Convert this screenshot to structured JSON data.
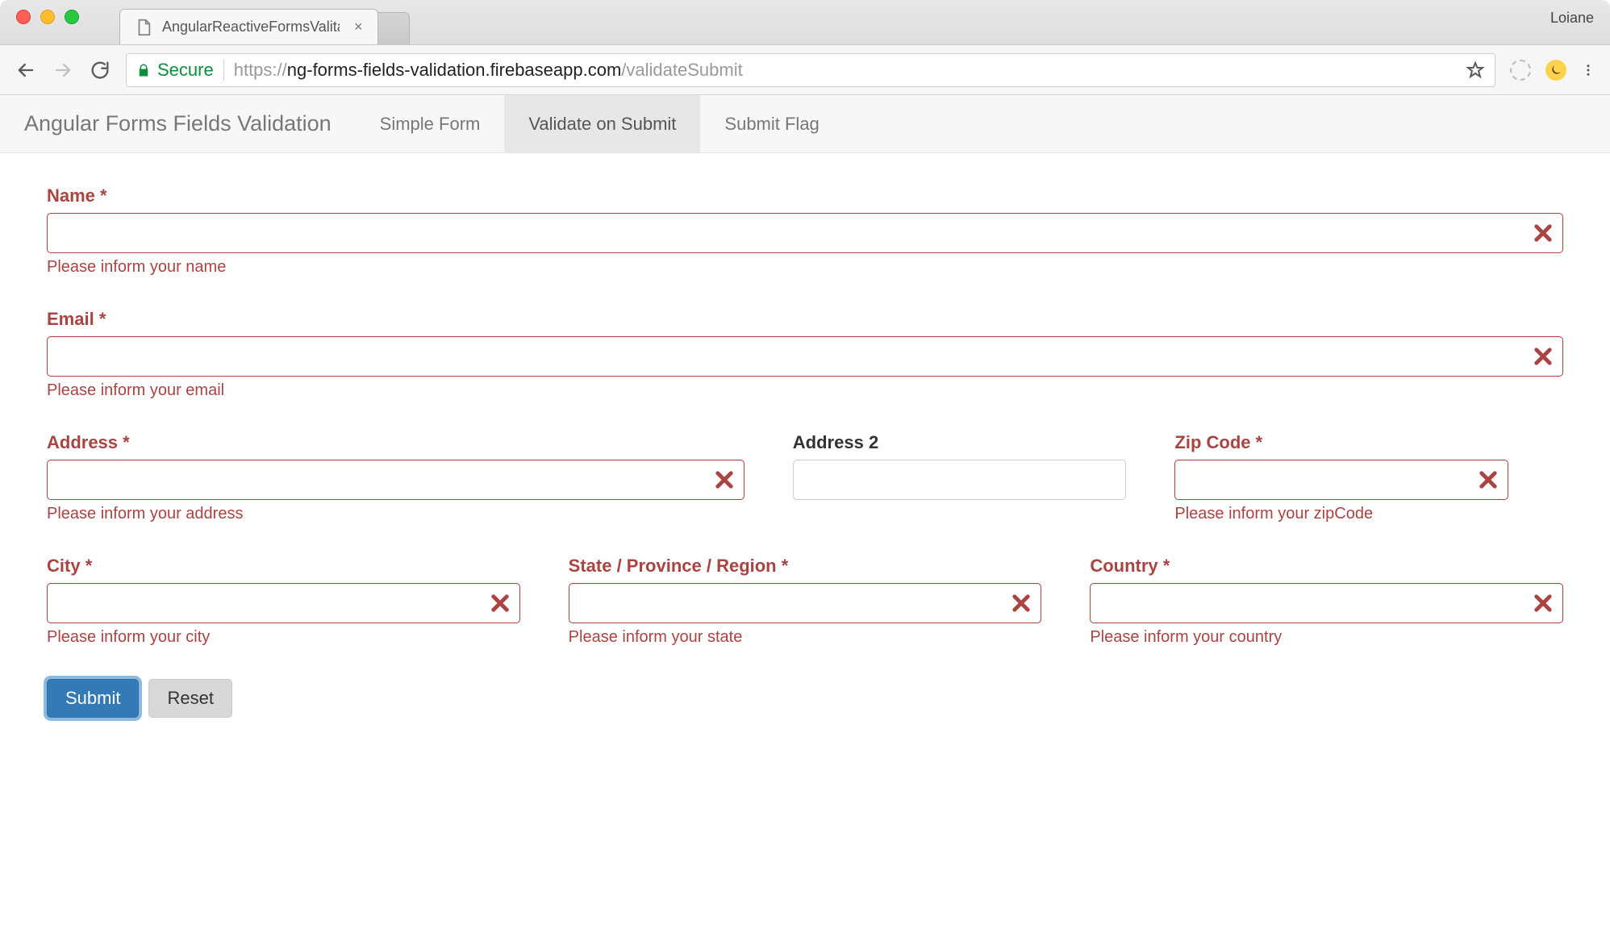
{
  "browser": {
    "profile_name": "Loiane",
    "tab_title": "AngularReactiveFormsValitateS",
    "secure_label": "Secure",
    "url_prefix": "https://",
    "url_host": "ng-forms-fields-validation.firebaseapp.com",
    "url_path": "/validateSubmit"
  },
  "nav": {
    "brand": "Angular Forms Fields Validation",
    "links": [
      {
        "label": "Simple Form",
        "active": false
      },
      {
        "label": "Validate on Submit",
        "active": true
      },
      {
        "label": "Submit Flag",
        "active": false
      }
    ]
  },
  "form": {
    "fields": {
      "name": {
        "label": "Name",
        "required": true,
        "error": "Please inform your name",
        "hasError": true
      },
      "email": {
        "label": "Email",
        "required": true,
        "error": "Please inform your email",
        "hasError": true
      },
      "address": {
        "label": "Address",
        "required": true,
        "error": "Please inform your address",
        "hasError": true
      },
      "address2": {
        "label": "Address 2",
        "required": false,
        "error": "",
        "hasError": false
      },
      "zip": {
        "label": "Zip Code",
        "required": true,
        "error": "Please inform your zipCode",
        "hasError": true
      },
      "city": {
        "label": "City",
        "required": true,
        "error": "Please inform your city",
        "hasError": true
      },
      "state": {
        "label": "State / Province / Region",
        "required": true,
        "error": "Please inform your state",
        "hasError": true
      },
      "country": {
        "label": "Country",
        "required": true,
        "error": "Please inform your country",
        "hasError": true
      }
    },
    "buttons": {
      "submit": "Submit",
      "reset": "Reset"
    }
  },
  "colors": {
    "error": "#a94442",
    "primary": "#337ab7"
  }
}
